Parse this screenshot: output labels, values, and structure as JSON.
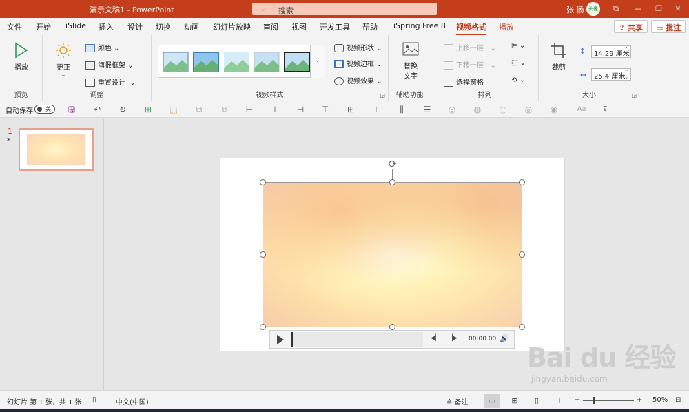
{
  "titlebar": {
    "doc_title": "演示文稿1  -  PowerPoint",
    "search_placeholder": "搜索",
    "user_name": "张 扬",
    "avatar_text": "头像",
    "btn_present": "⧉",
    "btn_minimize": "—",
    "btn_restore": "❐",
    "btn_close": "✕"
  },
  "menu": {
    "tabs": [
      "文件",
      "开始",
      "iSlide",
      "插入",
      "设计",
      "切换",
      "动画",
      "幻灯片放映",
      "审阅",
      "视图",
      "开发工具",
      "帮助",
      "iSpring Free 8",
      "视频格式",
      "播放"
    ],
    "active_tab": "视频格式",
    "share_label": "共享",
    "comment_label": "批注"
  },
  "ribbon": {
    "preview_group": {
      "label": "预览",
      "play_label": "播放"
    },
    "adjust_group": {
      "label": "调整",
      "correct_label": "更正",
      "color_label": "颜色",
      "poster_label": "海报框架",
      "reset_label": "重置设计"
    },
    "styles_group": {
      "label": "视频样式",
      "shape_label": "视频形状",
      "border_label": "视频边框",
      "effects_label": "视频效果"
    },
    "access_group": {
      "label": "辅助功能",
      "alt_text_line1": "替换",
      "alt_text_line2": "文字"
    },
    "arrange_group": {
      "label": "排列",
      "bring_forward": "上移一层",
      "send_backward": "下移一层",
      "selection_pane": "选择窗格"
    },
    "size_group": {
      "label": "大小",
      "crop_label": "裁剪",
      "height": "14.29 厘米",
      "width": "25.4 厘米"
    }
  },
  "qat": {
    "autosave_label": "自动保存",
    "autosave_state": "关",
    "font_size_label": "Aa"
  },
  "thumbnails": {
    "slide_number": "1",
    "marker": "*"
  },
  "player": {
    "time": "00:00.00"
  },
  "statusbar": {
    "slide_info": "幻灯片 第 1 张，共 1 张",
    "language": "中文(中国)",
    "notes_label": "备注",
    "zoom": "50%"
  },
  "watermark": {
    "logo": "Bai du 经验",
    "url": "jingyan.baidu.com"
  },
  "colors": {
    "accent": "#c43e1c",
    "ribbon_bg": "#f3f3f3",
    "canvas_bg": "#e6e6e6"
  },
  "icons": {
    "search": "magnifier-icon",
    "play": "play-triangle-icon",
    "crop": "crop-icon",
    "rotate": "rotate-handle-icon"
  }
}
